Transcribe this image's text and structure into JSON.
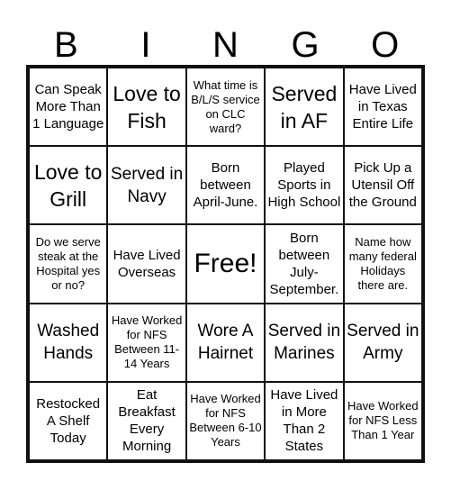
{
  "header": [
    "B",
    "I",
    "N",
    "G",
    "O"
  ],
  "cells": [
    {
      "text": "Can Speak More Than 1 Language",
      "size": "m"
    },
    {
      "text": "Love to Fish",
      "size": "xl"
    },
    {
      "text": "What time is B/L/S service on CLC ward?",
      "size": "s"
    },
    {
      "text": "Served in AF",
      "size": "xl"
    },
    {
      "text": "Have Lived in Texas Entire Life",
      "size": "m"
    },
    {
      "text": "Love to Grill",
      "size": "xl"
    },
    {
      "text": "Served in Navy",
      "size": "l"
    },
    {
      "text": "Born between April-June.",
      "size": "m"
    },
    {
      "text": "Played Sports in High School",
      "size": "m"
    },
    {
      "text": "Pick Up a Utensil Off the Ground",
      "size": "m"
    },
    {
      "text": "Do we serve steak at the Hospital yes or no?",
      "size": "s"
    },
    {
      "text": "Have Lived Overseas",
      "size": "m"
    },
    {
      "text": "Free!",
      "size": "free"
    },
    {
      "text": "Born between July-September.",
      "size": "m"
    },
    {
      "text": "Name how many federal Holidays there are.",
      "size": "s"
    },
    {
      "text": "Washed Hands",
      "size": "l"
    },
    {
      "text": "Have Worked for NFS Between 11-14 Years",
      "size": "s"
    },
    {
      "text": "Wore A Hairnet",
      "size": "l"
    },
    {
      "text": "Served in Marines",
      "size": "l"
    },
    {
      "text": "Served in Army",
      "size": "l"
    },
    {
      "text": "Restocked A Shelf Today",
      "size": "m"
    },
    {
      "text": "Eat Breakfast Every Morning",
      "size": "m"
    },
    {
      "text": "Have Worked for NFS Between 6-10 Years",
      "size": "s"
    },
    {
      "text": "Have Lived in More Than 2 States",
      "size": "m"
    },
    {
      "text": "Have Worked for NFS Less Than 1 Year",
      "size": "s"
    }
  ]
}
